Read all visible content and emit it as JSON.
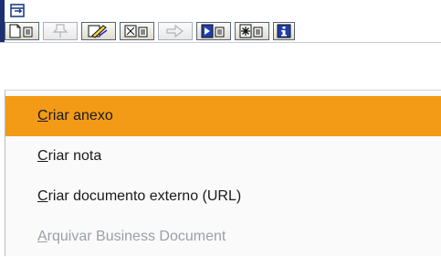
{
  "window": {
    "menu_icon": "menu-window-icon"
  },
  "toolbar": {
    "buttons": [
      {
        "icon": "create-document-icon",
        "enabled": true
      },
      {
        "icon": "attachment-pin-icon",
        "enabled": false
      },
      {
        "icon": "edit-note-icon",
        "enabled": true
      },
      {
        "icon": "attachment-list-icon",
        "enabled": true
      },
      {
        "icon": "send-arrow-icon",
        "enabled": false
      },
      {
        "icon": "play-document-icon",
        "enabled": true
      },
      {
        "icon": "star-document-icon",
        "enabled": true
      },
      {
        "icon": "info-icon",
        "enabled": true
      }
    ]
  },
  "menu": {
    "items": [
      {
        "mnemonic": "C",
        "rest": "riar anexo",
        "highlighted": true,
        "enabled": true
      },
      {
        "mnemonic": "C",
        "rest": "riar nota",
        "highlighted": false,
        "enabled": true
      },
      {
        "mnemonic": "C",
        "rest": "riar documento externo (URL)",
        "highlighted": false,
        "enabled": true
      },
      {
        "mnemonic": "A",
        "rest": "rquivar Business Document",
        "highlighted": false,
        "enabled": false
      }
    ]
  },
  "colors": {
    "highlight": "#f39b17",
    "disabled_text": "#9aa0a8",
    "strip": "#1c2f72"
  }
}
